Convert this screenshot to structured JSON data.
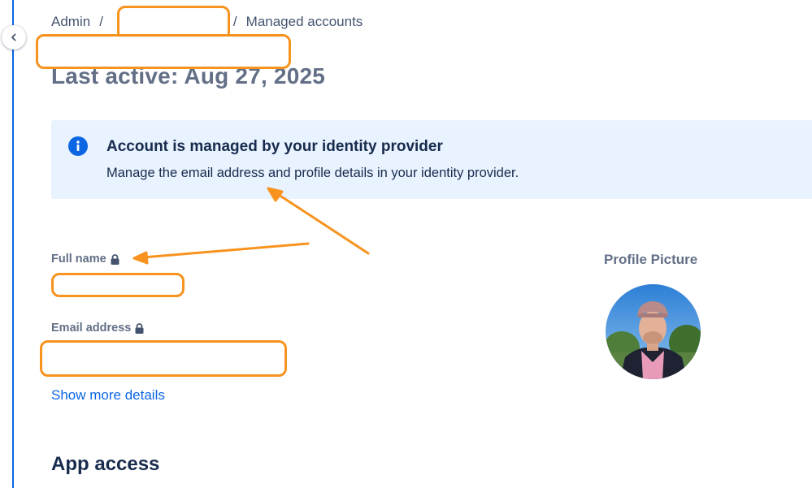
{
  "breadcrumb": {
    "root": "Admin",
    "separator": "/",
    "current": "Managed accounts"
  },
  "page": {
    "title": "Last active: Aug 27, 2025"
  },
  "banner": {
    "title": "Account is managed by your identity provider",
    "description": "Manage the email address and profile details in your identity provider."
  },
  "fields": {
    "full_name_label": "Full name",
    "email_label": "Email address"
  },
  "actions": {
    "show_more": "Show more details"
  },
  "profile": {
    "picture_label": "Profile Picture"
  },
  "sections": {
    "app_access": "App access"
  },
  "icons": {
    "collapse": "chevron-left-icon",
    "info": "info-icon",
    "lock": "lock-icon"
  },
  "colors": {
    "accent": "#0c66e4",
    "banner_bg": "#e9f2ff",
    "annotation": "#f7931e"
  }
}
